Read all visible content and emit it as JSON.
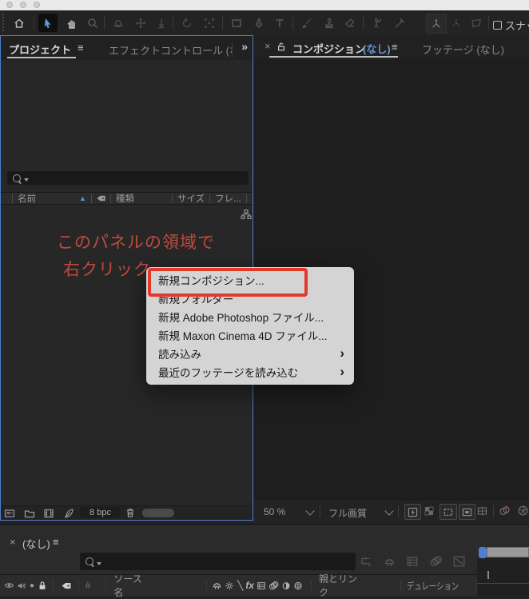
{
  "toolbar": {
    "snap_label": "スナップ"
  },
  "glyphs": {
    "menu": "≡",
    "close": "×",
    "overflow_chevrons": "»",
    "sort_asc": "▲",
    "submenu_arrow": "›",
    "fx": "fx",
    "hash": "#",
    "solo": "●",
    "backslash": "╲",
    "asterisk": "✳"
  },
  "project_panel": {
    "tab": "プロジェクト",
    "effect_controls_tab": "エフェクトコントロール (なし",
    "columns": {
      "name": "名前",
      "type": "種類",
      "size": "サイズ",
      "frame": "フレ..."
    },
    "annotation": {
      "line1": "このパネルの領域で",
      "line2": "右クリック"
    },
    "footer": {
      "bpc": "8 bpc"
    }
  },
  "composition_panel": {
    "composition_tab": "コンポジション",
    "composition_none": "(なし)",
    "footage_tab": "フッテージ (なし)",
    "zoom_level": "50 %",
    "quality": "フル画質"
  },
  "context_menu": {
    "items": [
      {
        "label": "新規コンポジション...",
        "highlighted": true
      },
      {
        "label": "新規フォルダー"
      },
      {
        "label": "新規 Adobe Photoshop ファイル..."
      },
      {
        "label": "新規 Maxon Cinema 4D ファイル..."
      },
      {
        "label": "読み込み",
        "submenu": true
      },
      {
        "label": "最近のフッテージを読み込む",
        "submenu": true
      }
    ]
  },
  "timeline_panel": {
    "tab_none": "(なし)",
    "columns": {
      "hash": "#",
      "source_name": "ソース名",
      "parent_link": "親とリンク",
      "duration": "デュレーション"
    }
  },
  "colors": {
    "focus_border": "#4c7ec9",
    "accent_blue": "#5b8ef0",
    "annotation_red": "#c04a3e",
    "highlight_box_red": "#e2392a",
    "menu_bg": "#d4d4d5",
    "panel_bg": "#272727"
  }
}
